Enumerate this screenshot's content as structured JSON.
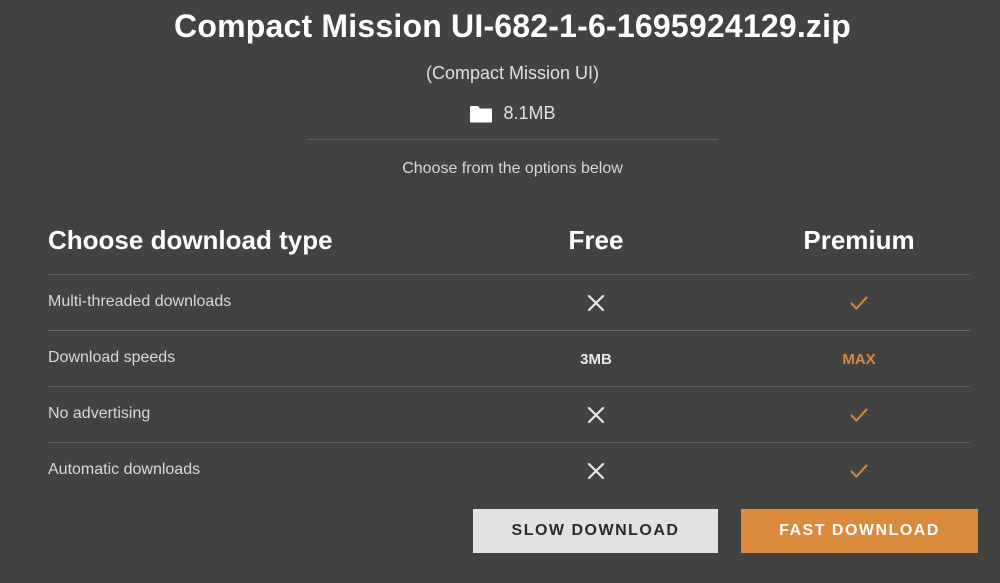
{
  "file": {
    "name": "Compact Mission UI-682-1-6-1695924129.zip",
    "subtitle": "(Compact Mission UI)",
    "size": "8.1MB",
    "size_icon": "folder-icon"
  },
  "prompt": "Choose from the options below",
  "table": {
    "header": {
      "type_label": "Choose download type",
      "free_label": "Free",
      "premium_label": "Premium"
    },
    "rows": [
      {
        "label": "Multi-threaded downloads",
        "free": "x-icon",
        "premium": "check-icon"
      },
      {
        "label": "Download speeds",
        "free": "3MB",
        "premium": "MAX"
      },
      {
        "label": "No advertising",
        "free": "x-icon",
        "premium": "check-icon"
      },
      {
        "label": "Automatic downloads",
        "free": "x-icon",
        "premium": "check-icon"
      }
    ]
  },
  "buttons": {
    "slow": "SLOW DOWNLOAD",
    "fast": "FAST DOWNLOAD"
  },
  "colors": {
    "background": "#424242",
    "accent": "#db8b3c",
    "slow_button": "#e2e2e2"
  }
}
